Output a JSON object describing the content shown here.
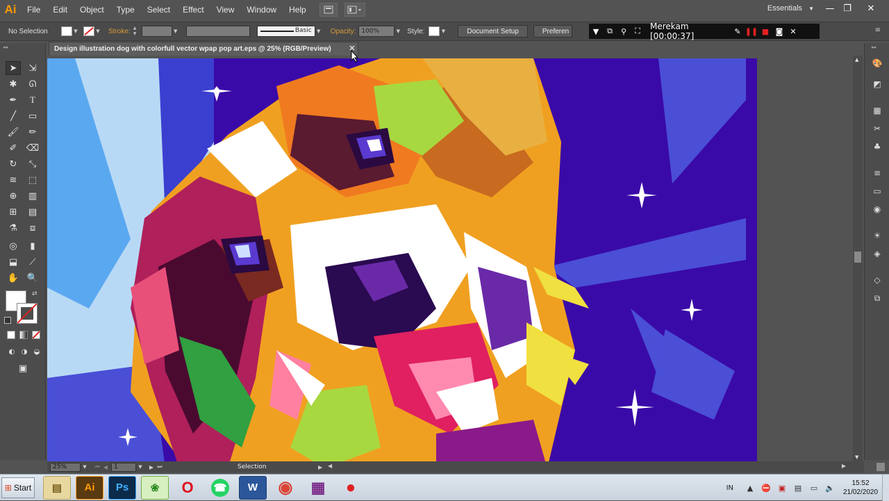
{
  "app": {
    "logo": "Ai"
  },
  "menu": {
    "items": [
      "File",
      "Edit",
      "Object",
      "Type",
      "Select",
      "Effect",
      "View",
      "Window",
      "Help"
    ]
  },
  "workspace": {
    "label": "Essentials"
  },
  "control_bar": {
    "selection": "No Selection",
    "stroke_label": "Stroke:",
    "brush": "Basic",
    "opacity_label": "Opacity:",
    "opacity_value": "100%",
    "style_label": "Style:",
    "document_setup": "Document Setup",
    "preferences": "Preferen"
  },
  "recorder": {
    "label": "Merekam [00:00:37]"
  },
  "document": {
    "tab_title": "Design illustration dog with colorfull vector wpap pop art.eps @ 25% (RGB/Preview)"
  },
  "status_bar": {
    "zoom": "25%",
    "page": "1",
    "tool": "Selection"
  },
  "taskbar": {
    "start": "Start",
    "language": "IN",
    "time": "15:52",
    "date": "21/02/2020",
    "apps": [
      {
        "name": "file-explorer",
        "glyph": "▤"
      },
      {
        "name": "illustrator",
        "glyph": "Ai"
      },
      {
        "name": "photoshop",
        "glyph": "Ps"
      },
      {
        "name": "coreldraw",
        "glyph": "❀"
      },
      {
        "name": "opera",
        "glyph": "O"
      },
      {
        "name": "whatsapp",
        "glyph": "☎"
      },
      {
        "name": "word",
        "glyph": "W"
      },
      {
        "name": "chrome",
        "glyph": "◉"
      },
      {
        "name": "winrar",
        "glyph": "▦"
      },
      {
        "name": "recorder",
        "glyph": "●"
      }
    ]
  },
  "colors": {
    "ui_dark": "#535353",
    "accent_orange": "#ff9a00",
    "art_purple": "#3a0aa8",
    "art_blue": "#4a4fd6"
  }
}
